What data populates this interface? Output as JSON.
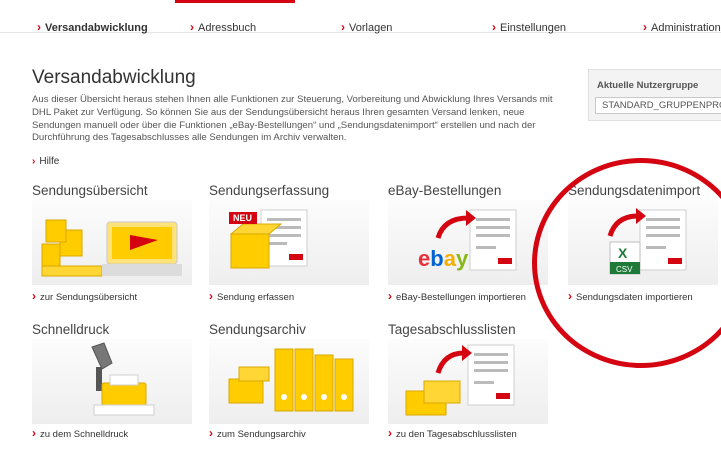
{
  "nav": {
    "items": [
      {
        "label": "Versandabwicklung"
      },
      {
        "label": "Adressbuch"
      },
      {
        "label": "Vorlagen"
      },
      {
        "label": "Einstellungen"
      },
      {
        "label": "Administration"
      }
    ]
  },
  "page": {
    "title": "Versandabwicklung",
    "intro": "Aus dieser Übersicht heraus stehen Ihnen alle Funktionen zur Steuerung, Vorbereitung und Abwicklung Ihres Versands mit DHL Paket zur Verfügung. So können Sie aus der Sendungsübersicht heraus Ihren gesamten Versand lenken, neue Sendungen manuell oder über die Funktionen „eBay-Bestellungen“ und „Sendungsdatenimport“ erstellen und nach der Durchführung des Tagesabschlusses alle Sendungen im Archiv verwalten.",
    "help_link": "Hilfe"
  },
  "group": {
    "label": "Aktuelle Nutzergruppe",
    "value": "STANDARD_GRUPPENPROFIL"
  },
  "tiles": [
    {
      "title": "Sendungsübersicht",
      "link": "zur Sendungsübersicht"
    },
    {
      "title": "Sendungserfassung",
      "link": "Sendung erfassen",
      "badge": "NEU"
    },
    {
      "title": "eBay-Bestellungen",
      "link": "eBay-Bestellungen importieren",
      "logo": "ebay"
    },
    {
      "title": "Sendungsdatenimport",
      "link": "Sendungsdaten importieren",
      "file_label": "CSV"
    },
    {
      "title": "Schnelldruck",
      "link": "zu dem Schnelldruck"
    },
    {
      "title": "Sendungsarchiv",
      "link": "zum Sendungsarchiv"
    },
    {
      "title": "Tagesabschlusslisten",
      "link": "zu den Tagesabschlusslisten"
    }
  ],
  "colors": {
    "accent": "#d40511",
    "dhl_yellow": "#ffcc00",
    "text": "#333333"
  }
}
